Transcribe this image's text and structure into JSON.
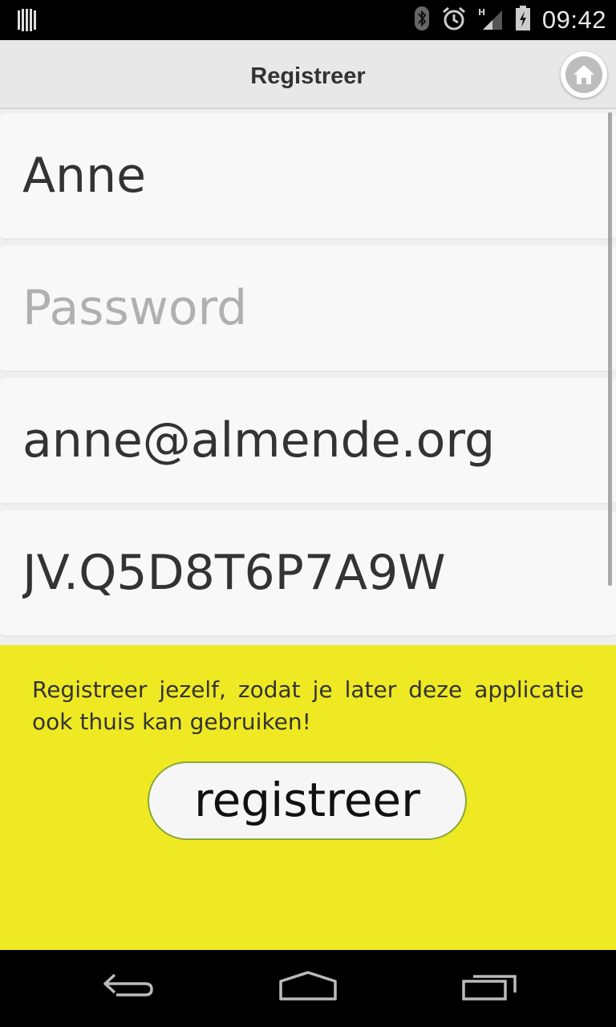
{
  "status_bar": {
    "time": "09:42",
    "icons": [
      "barcode-icon",
      "bluetooth-icon",
      "alarm-icon",
      "signal-icon",
      "battery-icon"
    ]
  },
  "header": {
    "title": "Registreer",
    "home_icon": "home-icon"
  },
  "form": {
    "name": {
      "value": "Anne",
      "placeholder": ""
    },
    "password": {
      "value": "",
      "placeholder": "Password"
    },
    "email": {
      "value": "anne@almende.org",
      "placeholder": ""
    },
    "code": {
      "value": "JV.Q5D8T6P7A9W",
      "placeholder": ""
    }
  },
  "panel": {
    "info": "Registreer jezelf, zodat je later deze applicatie ook thuis kan gebruiken!",
    "register_label": "registreer"
  },
  "colors": {
    "panel_bg": "#efe923",
    "header_bg": "#e8e8e8",
    "button_border": "#8aa63a"
  },
  "nav_bar": {
    "icons": [
      "back-icon",
      "home-nav-icon",
      "recent-apps-icon"
    ]
  }
}
